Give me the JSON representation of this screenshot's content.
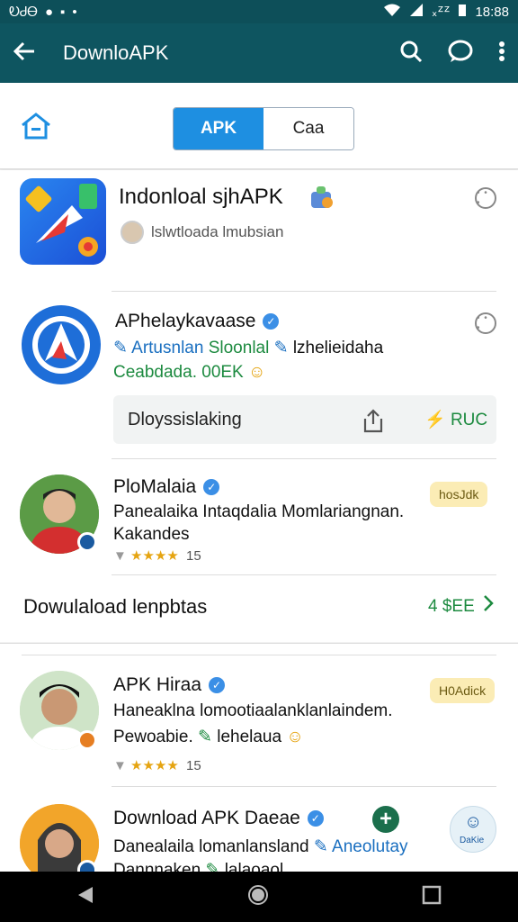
{
  "status": {
    "left_text": "ᎧᏧᎾ",
    "right_text": "᙮ᙆᙆ",
    "time": "18:88"
  },
  "appbar": {
    "title": "DownloAPK"
  },
  "tabs": {
    "active": "APK",
    "inactive": "Caa"
  },
  "items": [
    {
      "name": "Indonloal sjhAPK",
      "subtitle": "lslwtloada lmubsian"
    },
    {
      "name": "APhelaykavaase",
      "line1_a": "Artusnlan",
      "line1_b": "Sloonlal",
      "line1_c": "lzhelieidaha",
      "line2": "Ceabdada. 00EK",
      "download_label": "Dloyssislaking",
      "download_count": "RUC"
    },
    {
      "name": "PloMalaia",
      "line1": "Panealaika Intaqdalia Momlariangnan.",
      "line2": "Kakandes",
      "rating": "15",
      "badge": "hosJdk"
    }
  ],
  "footer": {
    "label": "Dowulaload lenpbtas",
    "count": "4 $EE"
  },
  "items2": [
    {
      "name": "APK Hiraa",
      "line1": "Haneaklna lomootiaalanklanlaindem.",
      "line2": "Pewoabie.",
      "line2_b": "lehelaua",
      "rating": "15",
      "badge": "H0Adick"
    },
    {
      "name": "Download APK Daeae",
      "line1_a": "Danealaila lomanlansland",
      "line1_b": "Aneolutay",
      "line2": "Dannnaken",
      "line2_b": "lalaoaol",
      "action_label": "DaKie"
    }
  ]
}
